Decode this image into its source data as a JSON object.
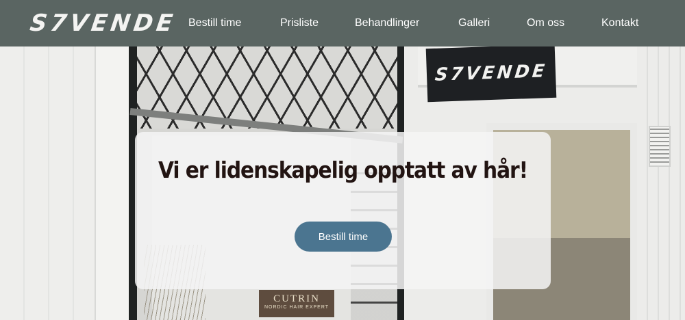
{
  "brand": {
    "logo_text": "S7VENDE"
  },
  "nav": {
    "items": [
      {
        "label": "Bestill time"
      },
      {
        "label": "Prisliste"
      },
      {
        "label": "Behandlinger"
      },
      {
        "label": "Galleri"
      },
      {
        "label": "Om oss"
      },
      {
        "label": "Kontakt"
      }
    ]
  },
  "hero": {
    "sign_text": "S7VENDE",
    "product_label": {
      "brand": "CUTRIN",
      "sub": "NORDIC HAIR EXPERT"
    },
    "heading": "Vi er lidenskapelig opptatt av hår!",
    "cta_label": "Bestill time"
  },
  "colors": {
    "header_bg": "#5a6562",
    "cta_bg": "#4b7590",
    "heading_text": "#221412"
  }
}
